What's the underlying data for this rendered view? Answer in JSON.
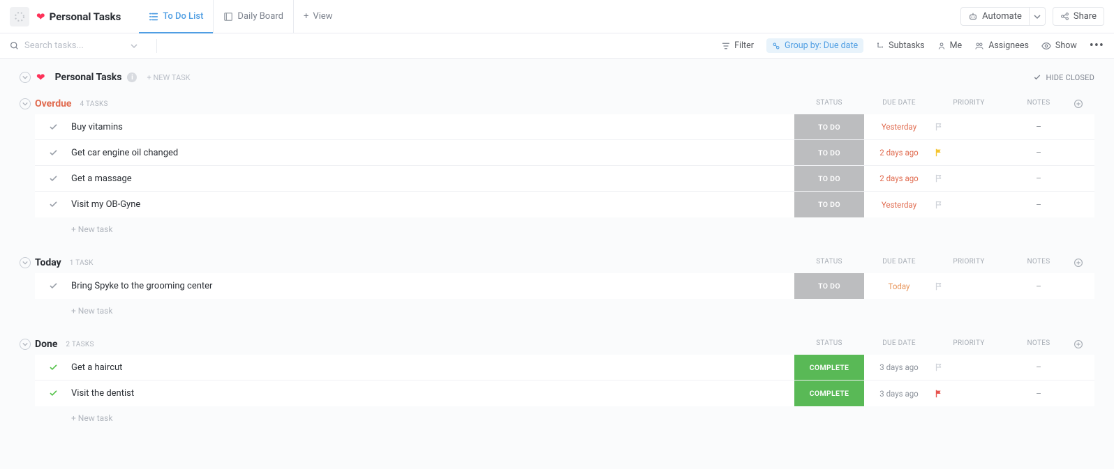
{
  "header": {
    "list_title": "Personal Tasks",
    "views": [
      {
        "label": "To Do List",
        "active": true,
        "icon": "list-icon"
      },
      {
        "label": "Daily Board",
        "active": false,
        "icon": "board-icon"
      }
    ],
    "add_view": "View",
    "automate": "Automate",
    "share": "Share"
  },
  "toolbar": {
    "search_placeholder": "Search tasks...",
    "filter": "Filter",
    "group_by": "Group by: Due date",
    "subtasks": "Subtasks",
    "me": "Me",
    "assignees": "Assignees",
    "show": "Show"
  },
  "space": {
    "title": "Personal Tasks",
    "new_task": "+ NEW TASK",
    "hide_closed": "HIDE CLOSED"
  },
  "columns": {
    "status": "STATUS",
    "due": "DUE DATE",
    "priority": "PRIORITY",
    "notes": "NOTES"
  },
  "status_labels": {
    "todo": "TO DO",
    "complete": "COMPLETE"
  },
  "new_task_row": "+ New task",
  "notes_placeholder": "–",
  "groups": [
    {
      "key": "overdue",
      "title": "Overdue",
      "count": "4 TASKS",
      "tasks": [
        {
          "name": "Buy vitamins",
          "status": "todo",
          "due": "Yesterday",
          "due_class": "overdue",
          "priority": "none"
        },
        {
          "name": "Get car engine oil changed",
          "status": "todo",
          "due": "2 days ago",
          "due_class": "overdue",
          "priority": "yellow"
        },
        {
          "name": "Get a massage",
          "status": "todo",
          "due": "2 days ago",
          "due_class": "overdue",
          "priority": "none"
        },
        {
          "name": "Visit my OB-Gyne",
          "status": "todo",
          "due": "Yesterday",
          "due_class": "overdue",
          "priority": "none"
        }
      ]
    },
    {
      "key": "today",
      "title": "Today",
      "count": "1 TASK",
      "tasks": [
        {
          "name": "Bring Spyke to the grooming center",
          "status": "todo",
          "due": "Today",
          "due_class": "todayc",
          "priority": "none"
        }
      ]
    },
    {
      "key": "done",
      "title": "Done",
      "count": "2 TASKS",
      "tasks": [
        {
          "name": "Get a haircut",
          "status": "complete",
          "due": "3 days ago",
          "due_class": "past",
          "priority": "none"
        },
        {
          "name": "Visit the dentist",
          "status": "complete",
          "due": "3 days ago",
          "due_class": "past",
          "priority": "red"
        }
      ]
    }
  ]
}
